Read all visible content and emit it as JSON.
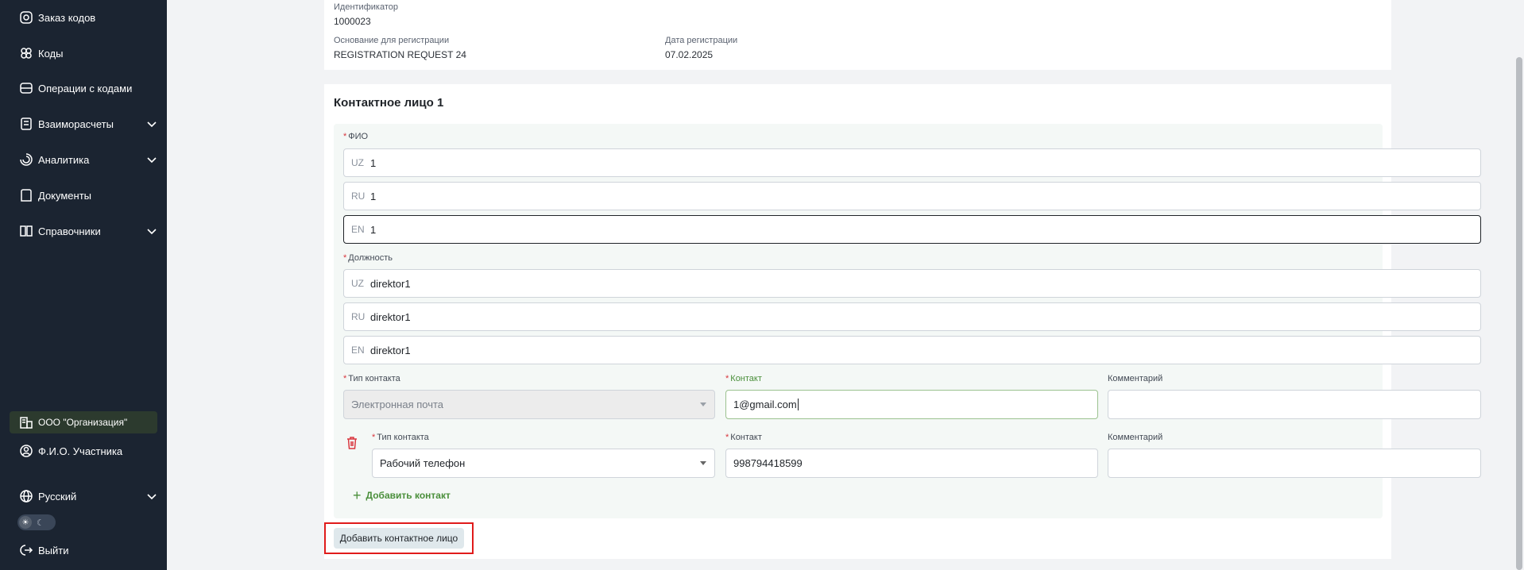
{
  "sidebar": {
    "items": [
      {
        "label": "Заказ кодов",
        "icon": "order-codes-icon",
        "expandable": false
      },
      {
        "label": "Коды",
        "icon": "codes-icon",
        "expandable": false
      },
      {
        "label": "Операции с кодами",
        "icon": "code-operations-icon",
        "expandable": false
      },
      {
        "label": "Взаиморасчеты",
        "icon": "settlements-icon",
        "expandable": true
      },
      {
        "label": "Аналитика",
        "icon": "analytics-icon",
        "expandable": true
      },
      {
        "label": "Документы",
        "icon": "documents-icon",
        "expandable": false
      },
      {
        "label": "Справочники",
        "icon": "reference-book-icon",
        "expandable": true
      }
    ],
    "organization": "ООО \"Организация\"",
    "participant": "Ф.И.О. Участника",
    "language": "Русский",
    "logout": "Выйти"
  },
  "registration": {
    "identifier_label": "Идентификатор",
    "identifier_value": "1000023",
    "basis_label": "Основание для регистрации",
    "basis_value": "REGISTRATION REQUEST 24",
    "date_label": "Дата регистрации",
    "date_value": "07.02.2025"
  },
  "contact_person": {
    "title": "Контактное лицо 1",
    "fio_label": "ФИО",
    "fio": [
      {
        "lang": "UZ",
        "value": "1"
      },
      {
        "lang": "RU",
        "value": "1"
      },
      {
        "lang": "EN",
        "value": "1"
      }
    ],
    "position_label": "Должность",
    "position": [
      {
        "lang": "UZ",
        "value": "direktor1"
      },
      {
        "lang": "RU",
        "value": "direktor1"
      },
      {
        "lang": "EN",
        "value": "direktor1"
      }
    ],
    "contact_type_label": "Тип контакта",
    "contact_label": "Контакт",
    "comment_label": "Комментарий",
    "contacts": [
      {
        "type": "Электронная почта",
        "value": "1@gmail.com",
        "comment": ""
      },
      {
        "type": "Рабочий телефон",
        "value": "998794418599",
        "comment": ""
      }
    ],
    "add_contact": "Добавить контакт"
  },
  "add_contact_person": "Добавить контактное лицо",
  "colors": {
    "sidebar_bg": "#1b2431",
    "accent_green": "#4a8f3b",
    "danger_red": "#d9363e",
    "highlight_red": "#e01b1b"
  }
}
